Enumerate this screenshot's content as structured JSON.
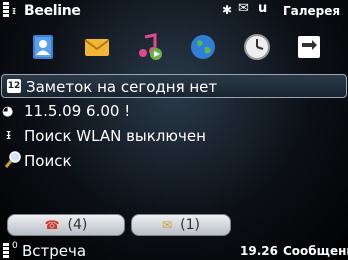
{
  "status_bar": {
    "operator": "Beeline",
    "antenna_glyph": "ᵻ",
    "bluetooth_glyph": "✱",
    "message_glyph": "✉",
    "u_glyph": "u",
    "right_label": "Галерея"
  },
  "shortcuts": [
    {
      "icon": "contacts-icon"
    },
    {
      "icon": "mail-icon"
    },
    {
      "icon": "music-icon"
    },
    {
      "icon": "globe-icon"
    },
    {
      "icon": "clock-icon"
    },
    {
      "icon": "switch-icon"
    }
  ],
  "list": {
    "row1": {
      "badge": "12",
      "text": "Заметок на сегодня нет"
    },
    "row2": {
      "text": "11.5.09 6.00 !"
    },
    "row3": {
      "text": "Поиск WLAN выключен"
    },
    "row4": {
      "text": "Поиск"
    }
  },
  "notifications": {
    "missed_calls": "(4)",
    "messages": "(1)"
  },
  "soft_keys": {
    "left": "Встреча",
    "left_sub": "0",
    "time": "19.26",
    "right": "Сообщения"
  }
}
